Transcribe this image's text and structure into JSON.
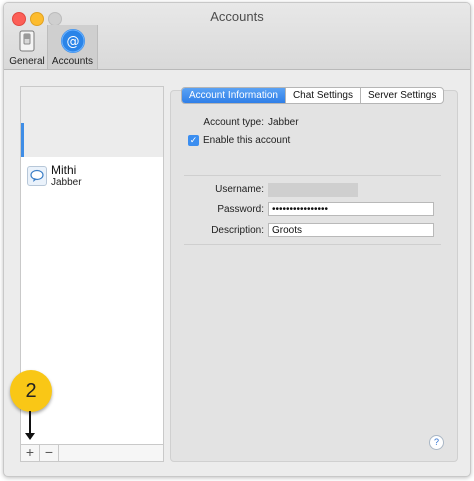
{
  "window": {
    "title": "Accounts"
  },
  "toolbar": {
    "general_label": "General",
    "accounts_label": "Accounts"
  },
  "sidebar": {
    "accounts": [
      {
        "name": "Mithi",
        "type": "Jabber"
      }
    ],
    "add_label": "+",
    "remove_label": "−"
  },
  "tabs": [
    {
      "label": "Account Information",
      "active": true
    },
    {
      "label": "Chat Settings",
      "active": false
    },
    {
      "label": "Server Settings",
      "active": false
    }
  ],
  "account_info": {
    "account_type_label": "Account type:",
    "account_type_value": "Jabber",
    "enable_label": "Enable this account",
    "enable_checked": true,
    "username_label": "Username:",
    "username_value": "",
    "password_label": "Password:",
    "password_value": "••••••••••••••••",
    "description_label": "Description:",
    "description_value": "Groots"
  },
  "help_label": "?",
  "annotation": {
    "number": "2"
  },
  "colors": {
    "accent": "#3b8ef0",
    "annotation": "#f9c716",
    "close": "#fc5f57",
    "minimize": "#fdbc2e"
  }
}
